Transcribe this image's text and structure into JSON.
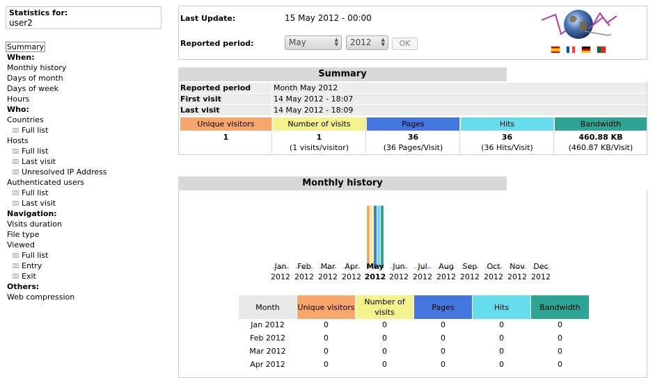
{
  "sidebar": {
    "stats_label": "Statistics for:",
    "user": "user2",
    "summary": "Summary",
    "when_head": "When:",
    "monthly_history": "Monthly history",
    "days_of_month": "Days of month",
    "days_of_week": "Days of week",
    "hours": "Hours",
    "who_head": "Who:",
    "countries": "Countries",
    "countries_full": "Full list",
    "hosts": "Hosts",
    "hosts_full": "Full list",
    "hosts_last": "Last visit",
    "hosts_unresolved": "Unresolved IP Address",
    "auth_users": "Authenticated users",
    "auth_full": "Full list",
    "auth_last": "Last visit",
    "nav_head": "Navigation:",
    "visits_duration": "Visits duration",
    "file_type": "File type",
    "viewed": "Viewed",
    "viewed_full": "Full list",
    "viewed_entry": "Entry",
    "viewed_exit": "Exit",
    "others_head": "Others:",
    "web_compression": "Web compression"
  },
  "top": {
    "last_update_label": "Last Update:",
    "last_update_value": "15 May 2012 - 00:00",
    "period_label": "Reported period:",
    "month_select": "May",
    "year_select": "2012",
    "ok_label": "OK",
    "flags": [
      "es",
      "fr",
      "de",
      "pt"
    ]
  },
  "summary": {
    "title": "Summary",
    "rows": [
      {
        "label": "Reported period",
        "value": "Month May 2012"
      },
      {
        "label": "First visit",
        "value": "14 May 2012 - 18:07"
      },
      {
        "label": "Last visit",
        "value": "14 May 2012 - 18:09"
      }
    ],
    "metrics": [
      {
        "label": "Unique visitors",
        "value": "1",
        "sub": "",
        "color": "#f9a66d"
      },
      {
        "label": "Number of visits",
        "value": "1",
        "sub": "(1 visits/visitor)",
        "color": "#f4f28d"
      },
      {
        "label": "Pages",
        "value": "36",
        "sub": "(36 Pages/Visit)",
        "color": "#4477dd"
      },
      {
        "label": "Hits",
        "value": "36",
        "sub": "(36 Hits/Visit)",
        "color": "#66dded"
      },
      {
        "label": "Bandwidth",
        "value": "460.88 KB",
        "sub": "(460.87 KB/Visit)",
        "color": "#2ea495"
      }
    ]
  },
  "monthly": {
    "title": "Monthly history",
    "current_month": "May",
    "year": "2012",
    "months": [
      "Jan",
      "Feb",
      "Mar",
      "Apr",
      "May",
      "Jun",
      "Jul",
      "Aug",
      "Sep",
      "Oct",
      "Nov",
      "Dec"
    ],
    "columns": [
      "Month",
      "Unique visitors",
      "Number of visits",
      "Pages",
      "Hits",
      "Bandwidth"
    ],
    "column_colors": [
      "#e8e8e8",
      "#f9a66d",
      "#f4f28d",
      "#4477dd",
      "#66dded",
      "#2ea495"
    ],
    "rows": [
      {
        "month": "Jan 2012",
        "unique": "0",
        "visits": "0",
        "pages": "0",
        "hits": "0",
        "bandwidth": "0"
      },
      {
        "month": "Feb 2012",
        "unique": "0",
        "visits": "0",
        "pages": "0",
        "hits": "0",
        "bandwidth": "0"
      },
      {
        "month": "Mar 2012",
        "unique": "0",
        "visits": "0",
        "pages": "0",
        "hits": "0",
        "bandwidth": "0"
      },
      {
        "month": "Apr 2012",
        "unique": "0",
        "visits": "0",
        "pages": "0",
        "hits": "0",
        "bandwidth": "0"
      }
    ]
  },
  "chart_data": {
    "type": "bar",
    "categories": [
      "Jan 2012",
      "Feb 2012",
      "Mar 2012",
      "Apr 2012",
      "May 2012",
      "Jun 2012",
      "Jul 2012",
      "Aug 2012",
      "Sep 2012",
      "Oct 2012",
      "Nov 2012",
      "Dec 2012"
    ],
    "series": [
      {
        "name": "Unique visitors",
        "color": "#f9a66d",
        "values": [
          0,
          0,
          0,
          0,
          1,
          0,
          0,
          0,
          0,
          0,
          0,
          0
        ]
      },
      {
        "name": "Number of visits",
        "color": "#f4f28d",
        "values": [
          0,
          0,
          0,
          0,
          1,
          0,
          0,
          0,
          0,
          0,
          0,
          0
        ]
      },
      {
        "name": "Pages",
        "color": "#4477dd",
        "values": [
          0,
          0,
          0,
          0,
          36,
          0,
          0,
          0,
          0,
          0,
          0,
          0
        ]
      },
      {
        "name": "Hits",
        "color": "#66dded",
        "values": [
          0,
          0,
          0,
          0,
          36,
          0,
          0,
          0,
          0,
          0,
          0,
          0
        ]
      },
      {
        "name": "Bandwidth",
        "color": "#2ea495",
        "values": [
          0,
          0,
          0,
          0,
          460.88,
          0,
          0,
          0,
          0,
          0,
          0,
          0
        ]
      }
    ],
    "legend": "none",
    "grid": false
  }
}
